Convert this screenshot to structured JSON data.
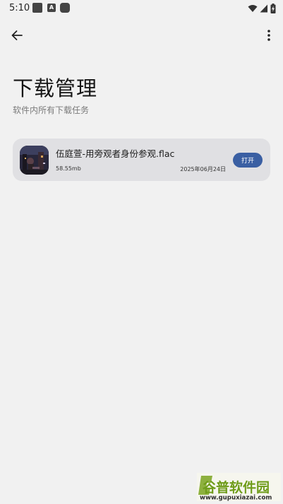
{
  "status_bar": {
    "time": "5:10",
    "a_icon_text": "A",
    "icons": [
      "notification-square-icon",
      "a-badge-icon",
      "app-notification-icon",
      "wifi-icon",
      "signal-icon",
      "battery-charging-icon"
    ]
  },
  "app_bar": {
    "back_icon": "arrow-left-icon",
    "more_icon": "more-vert-icon"
  },
  "header": {
    "title": "下载管理",
    "subtitle": "软件内所有下载任务"
  },
  "downloads": [
    {
      "file_name": "伍庭萱-用旁观者身份参观.flac",
      "size": "58.55mb",
      "date": "2025年06月24日",
      "action_label": "打开"
    }
  ],
  "watermark": {
    "brand": "谷普软件园",
    "url": "www.gupuxiazai.com"
  },
  "colors": {
    "background": "#f1f1f1",
    "card": "#e0e0e3",
    "accent": "#3a5fa3",
    "watermark_green": "#6f9c1a"
  }
}
